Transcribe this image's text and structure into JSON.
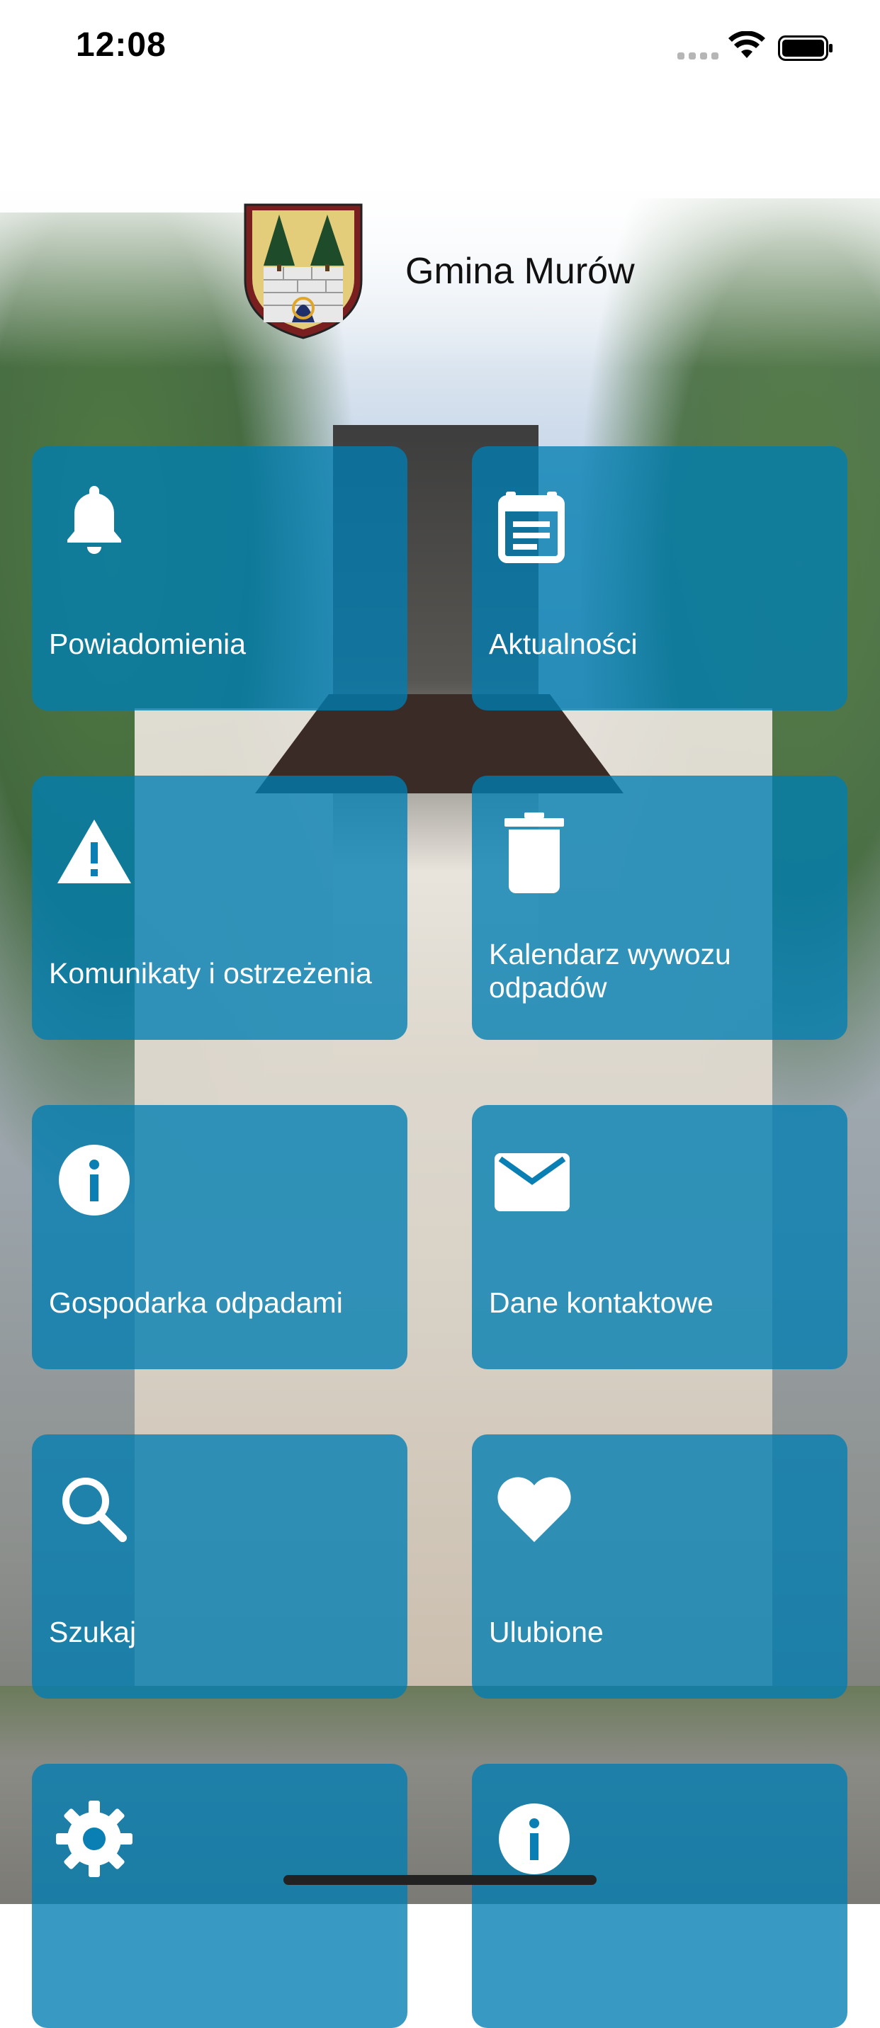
{
  "status_bar": {
    "time": "12:08",
    "wifi_icon": "wifi-icon",
    "battery_icon": "battery-icon"
  },
  "header": {
    "title": "Gmina Murów",
    "logo_icon": "crest-logo"
  },
  "tiles": [
    {
      "label": "Powiadomienia",
      "icon": "bell-icon"
    },
    {
      "label": "Aktualności",
      "icon": "calendar-news-icon"
    },
    {
      "label": "Komunikaty i ostrzeżenia",
      "icon": "warning-icon"
    },
    {
      "label": "Kalendarz wywozu odpadów",
      "icon": "trash-icon"
    },
    {
      "label": "Gospodarka odpadami",
      "icon": "info-icon"
    },
    {
      "label": "Dane kontaktowe",
      "icon": "mail-icon"
    },
    {
      "label": "Szukaj",
      "icon": "search-icon"
    },
    {
      "label": "Ulubione",
      "icon": "heart-icon"
    },
    {
      "label": "",
      "icon": "gear-icon"
    },
    {
      "label": "",
      "icon": "info-icon"
    }
  ],
  "colors": {
    "tile_background": "#007EB2",
    "tile_text": "#FFFFFF",
    "title_text": "#111111"
  }
}
